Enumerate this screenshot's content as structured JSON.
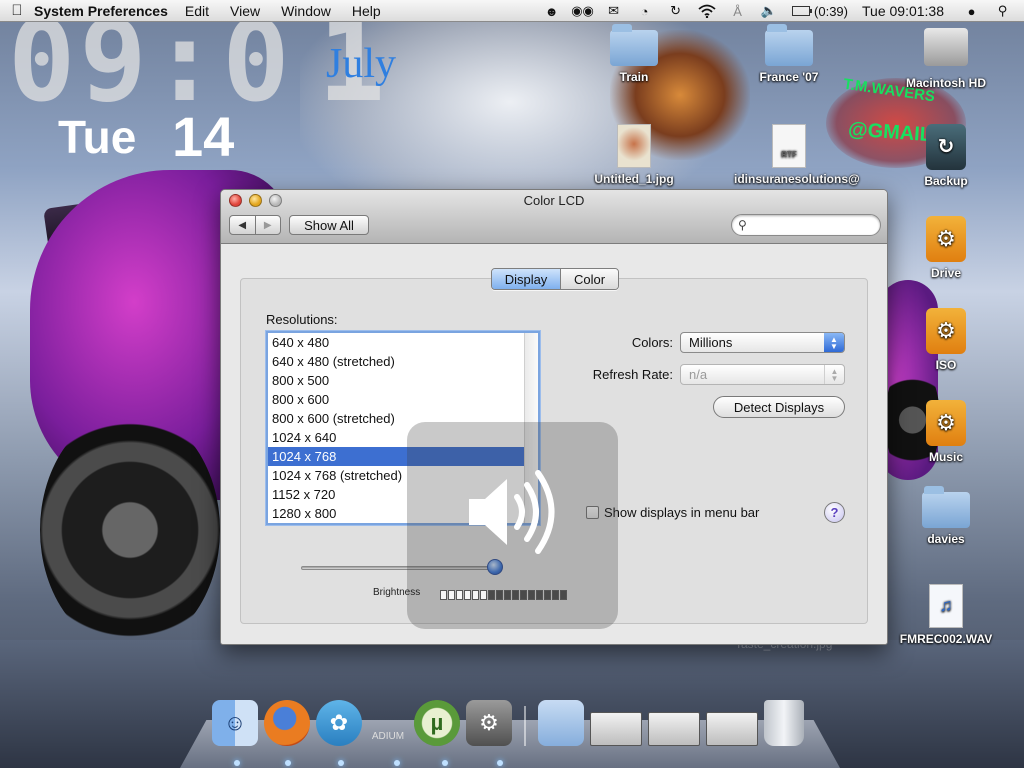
{
  "menubar": {
    "app": "System Preferences",
    "items": [
      "Edit",
      "View",
      "Window",
      "Help"
    ],
    "battery": "(0:39)",
    "clock": "Tue 09:01:38"
  },
  "desktop_widget": {
    "time": "09:0",
    "time_extra": "1",
    "month": "July",
    "day_name": "Tue",
    "day_number": "14"
  },
  "stamp": {
    "line1": "T.M.WAVERS",
    "line2": "@GMAIL.C"
  },
  "desktop_icons": {
    "train": "Train",
    "france": "France '07",
    "macintosh_hd": "Macintosh HD",
    "untitled": "Untitled_1.jpg",
    "rtf_doc": "idinsuranesolutions@",
    "rtf_badge": "RTF",
    "backup": "Backup",
    "drive": "Drive",
    "iso": "ISO",
    "music": "Music",
    "davies": "davies",
    "wav": "FMREC002.WAV",
    "faint_file": "Taste_creation.jpg"
  },
  "window": {
    "title": "Color LCD",
    "show_all": "Show All",
    "search_placeholder": "",
    "tabs": [
      {
        "label": "Display",
        "active": true
      },
      {
        "label": "Color",
        "active": false
      }
    ],
    "resolutions_label": "Resolutions:",
    "resolutions": [
      "640 x 480",
      "640 x 480 (stretched)",
      "800 x 500",
      "800 x 600",
      "800 x 600 (stretched)",
      "1024 x 640",
      "1024 x 768",
      "1024 x 768 (stretched)",
      "1152 x 720",
      "1280 x 800"
    ],
    "selected_resolution": "1024 x 768",
    "colors_label": "Colors:",
    "colors_value": "Millions",
    "refresh_label": "Refresh Rate:",
    "refresh_value": "n/a",
    "detect_button": "Detect Displays",
    "menu_bar_checkbox": "Show displays in menu bar",
    "menu_bar_checked": false,
    "help": "?",
    "brightness_label": "Brightness",
    "brightness_level": 0.97
  },
  "volume_hud": {
    "segments_total": 16,
    "segments_on": 6
  },
  "dock": {
    "adium_label": "ADIUM",
    "apps": [
      "finder-icon",
      "firefox-icon",
      "twitter-icon",
      "adium-icon",
      "utorrent-icon",
      "system-preferences-icon",
      "documents-stack-icon",
      "window-thumbnail-icon",
      "window-thumbnail-icon",
      "window-thumbnail-icon",
      "trash-icon"
    ]
  },
  "colors": {
    "accent": "#3d6fd1",
    "month_blue": "#2f7fe0"
  }
}
